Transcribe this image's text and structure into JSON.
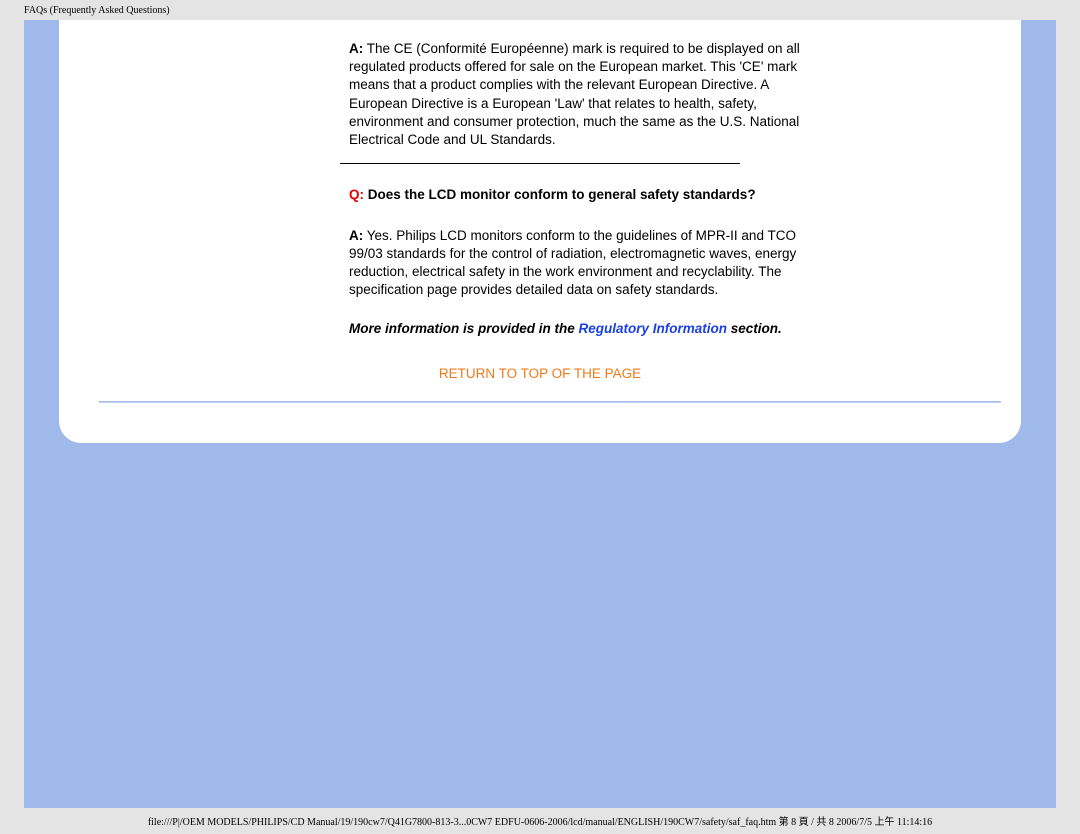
{
  "header": {
    "title": "FAQs (Frequently Asked Questions)"
  },
  "faq": {
    "a1_label": "A:",
    "a1_text": " The CE (Conformité Européenne) mark is required to be displayed on all regulated products offered for sale on the European market. This 'CE' mark means that a product complies with the relevant European Directive. A European Directive is a European 'Law' that relates to health, safety, environment and consumer protection, much the same as the U.S. National Electrical Code and UL Standards.",
    "q2_label": "Q:",
    "q2_text": " Does the LCD monitor conform to general safety standards?",
    "a2_label": "A:",
    "a2_text": " Yes. Philips LCD monitors conform to the guidelines of MPR-II and TCO 99/03 standards for the control of radiation, electromagnetic waves, energy reduction, electrical safety in the work environment and recyclability. The specification page provides detailed data on safety standards.",
    "more_info_pre": "More information is provided in the ",
    "more_info_link": "Regulatory Information",
    "more_info_post": " section.",
    "return_top": "RETURN TO TOP OF THE PAGE"
  },
  "footer": {
    "path": "file:///P|/OEM MODELS/PHILIPS/CD Manual/19/190cw7/Q41G7800-813-3...0CW7 EDFU-0606-2006/lcd/manual/ENGLISH/190CW7/safety/saf_faq.htm 第 8 頁 / 共 8 2006/7/5 上午 11:14:16"
  }
}
